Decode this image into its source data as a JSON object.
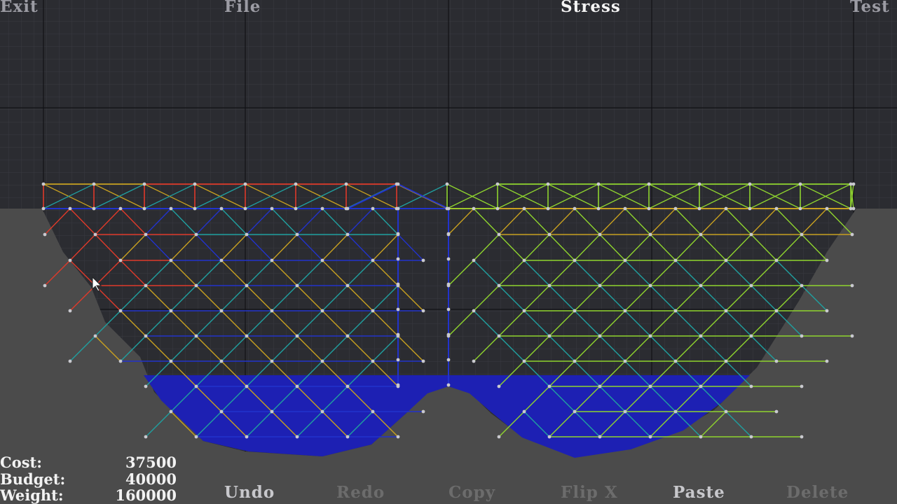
{
  "menu": {
    "exit": "Exit",
    "file": "File",
    "stress": "Stress",
    "test": "Test"
  },
  "stats": [
    {
      "label": "Cost:",
      "value": "37500"
    },
    {
      "label": "Budget:",
      "value": "40000"
    },
    {
      "label": "Weight:",
      "value": "160000"
    }
  ],
  "toolbar": {
    "undo": "Undo",
    "redo": "Redo",
    "copy": "Copy",
    "flip_x": "Flip X",
    "paste": "Paste",
    "delete": "Delete"
  },
  "colors": {
    "sky": "#2b2c31",
    "grid_minor": "#3a3b42",
    "grid_major": "#111114",
    "terrain": "#4a4a4a",
    "water": "#1c1fb0",
    "node": "#c9c9cf",
    "stress_high_tension": "#e03a2a",
    "stress_medium": "#c8a020",
    "stress_low": "#8fd42e",
    "stress_neutral": "#20a0a0",
    "stress_compression": "#2233cc"
  },
  "icons": {
    "cursor": "mouse-pointer-icon"
  }
}
